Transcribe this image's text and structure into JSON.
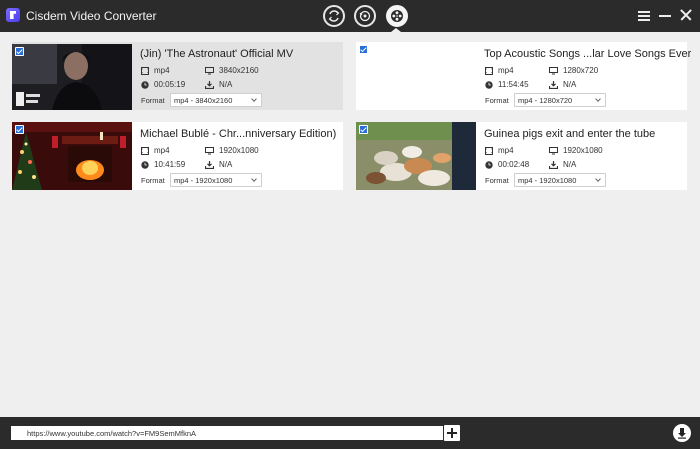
{
  "app": {
    "title": "Cisdem Video Converter",
    "modes": [
      {
        "name": "convert",
        "icon": "convert-icon"
      },
      {
        "name": "rip",
        "icon": "rip-icon"
      },
      {
        "name": "download",
        "icon": "film-reel-icon",
        "active": true
      }
    ],
    "window_controls": [
      "menu-icon",
      "minimize-icon",
      "close-icon"
    ]
  },
  "labels": {
    "format": "Format"
  },
  "videos": [
    {
      "title": "(Jin) 'The Astronaut' Official MV",
      "container": "mp4",
      "resolution": "3840x2160",
      "duration": "00:05:19",
      "size": "N/A",
      "format": "mp4 - 3840x2160",
      "checked": true,
      "selected": true
    },
    {
      "title": "Top Acoustic Songs ...lar Love Songs Ever",
      "container": "mp4",
      "resolution": "1280x720",
      "duration": "11:54:45",
      "size": "N/A",
      "format": "mp4 - 1280x720",
      "checked": true,
      "selected": false
    },
    {
      "title": "Michael Bublé - Chr...nniversary Edition)",
      "container": "mp4",
      "resolution": "1920x1080",
      "duration": "10:41:59",
      "size": "N/A",
      "format": "mp4 - 1920x1080",
      "checked": true,
      "selected": false
    },
    {
      "title": "Guinea pigs exit and enter the tube",
      "container": "mp4",
      "resolution": "1920x1080",
      "duration": "00:02:48",
      "size": "N/A",
      "format": "mp4 - 1920x1080",
      "checked": true,
      "selected": false
    }
  ],
  "bottom": {
    "url_value": "https://www.youtube.com/watch?v=FM9SemMfknA"
  },
  "colors": {
    "titlebar": "#2b2b2b",
    "background": "#efefef",
    "checkbox": "#2a6fd6"
  }
}
